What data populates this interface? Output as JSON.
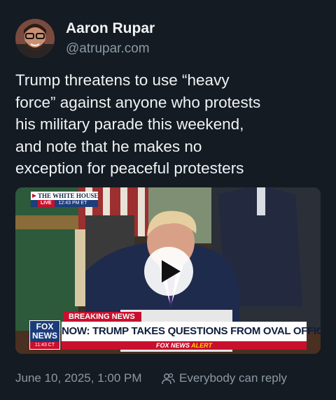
{
  "author": {
    "name": "Aaron Rupar",
    "handle": "@atrupar.com"
  },
  "post": {
    "lines": [
      "Trump threatens to use “heavy",
      "force” against anyone who protests",
      "his military parade this weekend,",
      "and note that he makes no",
      "exception for peaceful protesters"
    ]
  },
  "video": {
    "bug_title": "THE WHITE HOUSE",
    "bug_live": "LIVE",
    "bug_time": "12:43 PM ET",
    "breaking": "BREAKING NEWS",
    "headline": "NOW: TRUMP TAKES QUESTIONS FROM OVAL OFFICE",
    "alert_prefix": "FOX NEWS",
    "alert_word": "ALERT",
    "logo_top": "FOX",
    "logo_bottom": "NEWS",
    "logo_time": "11:43 CT",
    "icon": "play-icon"
  },
  "footer": {
    "date": "June 10, 2025, 1:00 PM",
    "reply_setting": "Everybody can reply",
    "icon": "people-icon"
  },
  "colors": {
    "background": "#141b22",
    "text": "#f1f3f5",
    "muted": "#8c99a6",
    "fox_red": "#c8102e",
    "fox_blue": "#1a3c7a"
  }
}
